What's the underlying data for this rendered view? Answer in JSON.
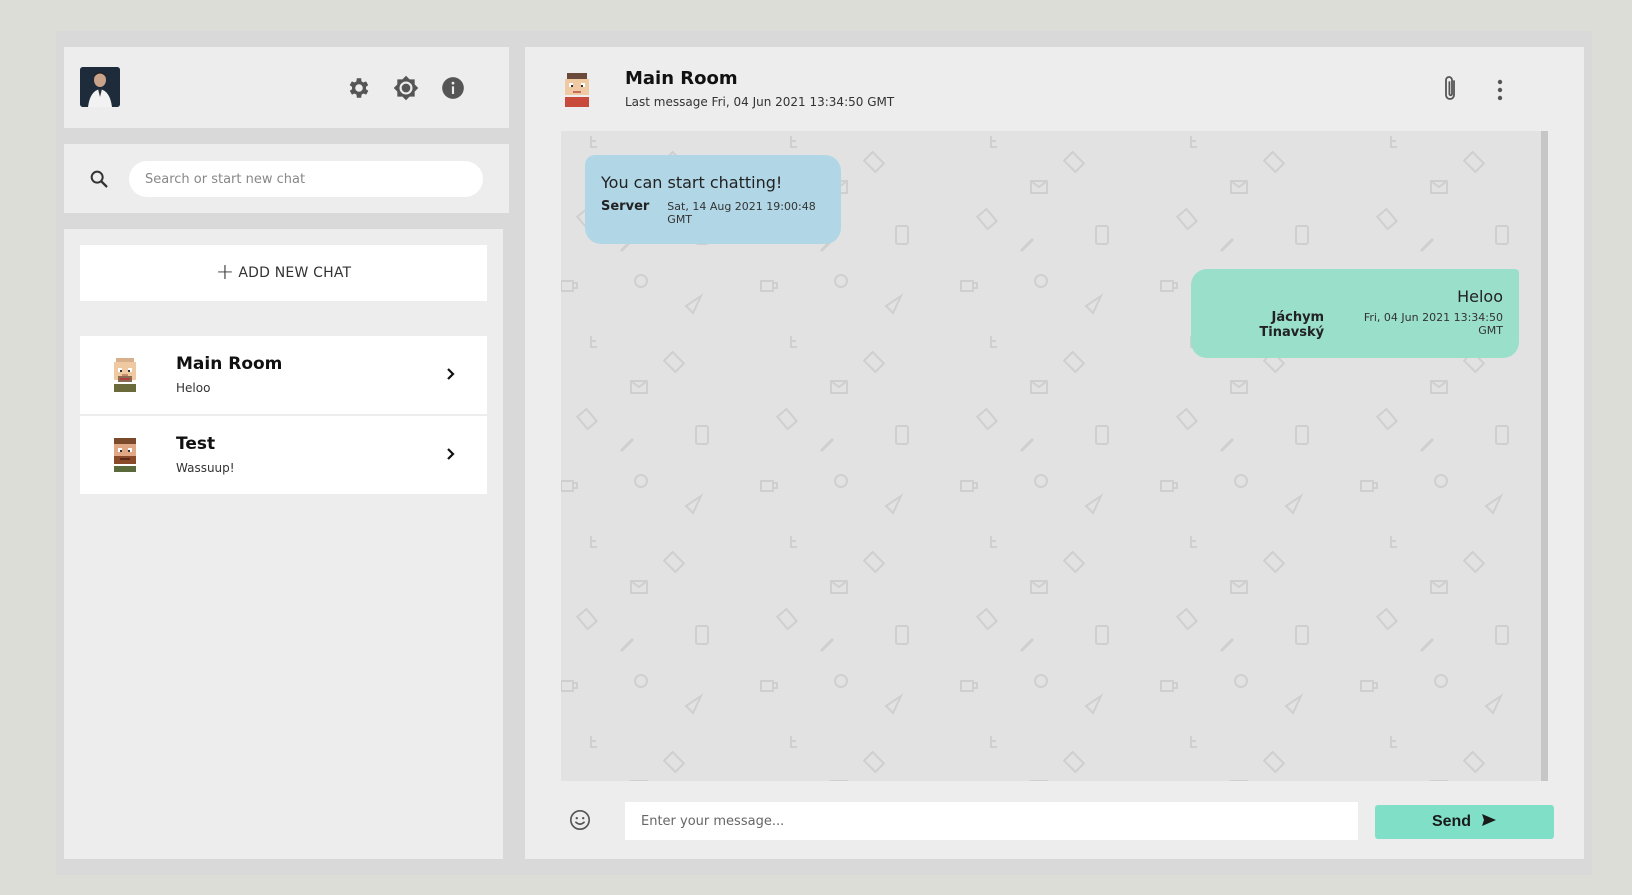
{
  "sidebar": {
    "search_placeholder": "Search or start new chat",
    "add_chat_label": "ADD NEW CHAT",
    "add_chat_icon": "plus-icon",
    "header_icons": [
      "gear-icon",
      "brightness-icon",
      "info-icon"
    ],
    "chats": [
      {
        "name": "Main Room",
        "last_message": "Heloo",
        "avatar_icon": "pixel-avatar-1"
      },
      {
        "name": "Test",
        "last_message": "Wassuup!",
        "avatar_icon": "pixel-avatar-2"
      }
    ]
  },
  "room": {
    "title": "Main Room",
    "subtitle": "Last message Fri, 04 Jun 2021 13:34:50 GMT",
    "icons": [
      "paperclip-icon",
      "more-vertical-icon"
    ]
  },
  "messages": [
    {
      "text": "You can start chatting!",
      "author": "Server",
      "time": "Sat, 14 Aug 2021 19:00:48 GMT",
      "direction": "incoming",
      "color": "#b1d7e6"
    },
    {
      "text": "Heloo",
      "author": "Jáchym Tinavský",
      "time": "Fri, 04 Jun 2021 13:34:50 GMT",
      "direction": "outgoing",
      "color": "#99dfc9"
    }
  ],
  "composer": {
    "placeholder": "Enter your message...",
    "send_label": "Send",
    "send_icon": "send-arrow-icon",
    "emoji_icon": "smiley-icon"
  },
  "colors": {
    "accent": "#7fe0c7",
    "incoming_bubble": "#b1d7e6",
    "outgoing_bubble": "#99dfc9",
    "panel": "#ededed"
  }
}
